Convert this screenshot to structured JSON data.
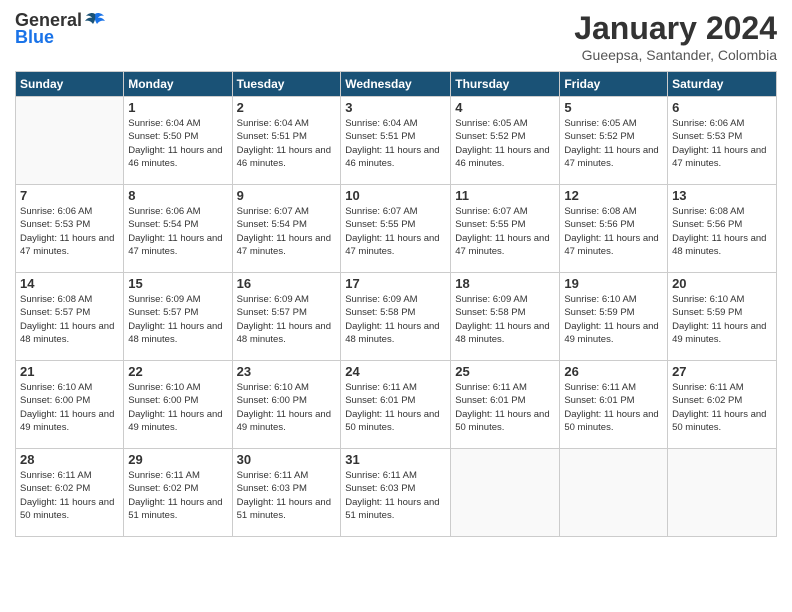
{
  "header": {
    "logo_general": "General",
    "logo_blue": "Blue",
    "month_title": "January 2024",
    "location": "Gueepsa, Santander, Colombia"
  },
  "days_of_week": [
    "Sunday",
    "Monday",
    "Tuesday",
    "Wednesday",
    "Thursday",
    "Friday",
    "Saturday"
  ],
  "weeks": [
    [
      {
        "day": "",
        "empty": true
      },
      {
        "day": "1",
        "sunrise": "6:04 AM",
        "sunset": "5:50 PM",
        "daylight": "11 hours and 46 minutes."
      },
      {
        "day": "2",
        "sunrise": "6:04 AM",
        "sunset": "5:51 PM",
        "daylight": "11 hours and 46 minutes."
      },
      {
        "day": "3",
        "sunrise": "6:04 AM",
        "sunset": "5:51 PM",
        "daylight": "11 hours and 46 minutes."
      },
      {
        "day": "4",
        "sunrise": "6:05 AM",
        "sunset": "5:52 PM",
        "daylight": "11 hours and 46 minutes."
      },
      {
        "day": "5",
        "sunrise": "6:05 AM",
        "sunset": "5:52 PM",
        "daylight": "11 hours and 47 minutes."
      },
      {
        "day": "6",
        "sunrise": "6:06 AM",
        "sunset": "5:53 PM",
        "daylight": "11 hours and 47 minutes."
      }
    ],
    [
      {
        "day": "7",
        "sunrise": "6:06 AM",
        "sunset": "5:53 PM",
        "daylight": "11 hours and 47 minutes."
      },
      {
        "day": "8",
        "sunrise": "6:06 AM",
        "sunset": "5:54 PM",
        "daylight": "11 hours and 47 minutes."
      },
      {
        "day": "9",
        "sunrise": "6:07 AM",
        "sunset": "5:54 PM",
        "daylight": "11 hours and 47 minutes."
      },
      {
        "day": "10",
        "sunrise": "6:07 AM",
        "sunset": "5:55 PM",
        "daylight": "11 hours and 47 minutes."
      },
      {
        "day": "11",
        "sunrise": "6:07 AM",
        "sunset": "5:55 PM",
        "daylight": "11 hours and 47 minutes."
      },
      {
        "day": "12",
        "sunrise": "6:08 AM",
        "sunset": "5:56 PM",
        "daylight": "11 hours and 47 minutes."
      },
      {
        "day": "13",
        "sunrise": "6:08 AM",
        "sunset": "5:56 PM",
        "daylight": "11 hours and 48 minutes."
      }
    ],
    [
      {
        "day": "14",
        "sunrise": "6:08 AM",
        "sunset": "5:57 PM",
        "daylight": "11 hours and 48 minutes."
      },
      {
        "day": "15",
        "sunrise": "6:09 AM",
        "sunset": "5:57 PM",
        "daylight": "11 hours and 48 minutes."
      },
      {
        "day": "16",
        "sunrise": "6:09 AM",
        "sunset": "5:57 PM",
        "daylight": "11 hours and 48 minutes."
      },
      {
        "day": "17",
        "sunrise": "6:09 AM",
        "sunset": "5:58 PM",
        "daylight": "11 hours and 48 minutes."
      },
      {
        "day": "18",
        "sunrise": "6:09 AM",
        "sunset": "5:58 PM",
        "daylight": "11 hours and 48 minutes."
      },
      {
        "day": "19",
        "sunrise": "6:10 AM",
        "sunset": "5:59 PM",
        "daylight": "11 hours and 49 minutes."
      },
      {
        "day": "20",
        "sunrise": "6:10 AM",
        "sunset": "5:59 PM",
        "daylight": "11 hours and 49 minutes."
      }
    ],
    [
      {
        "day": "21",
        "sunrise": "6:10 AM",
        "sunset": "6:00 PM",
        "daylight": "11 hours and 49 minutes."
      },
      {
        "day": "22",
        "sunrise": "6:10 AM",
        "sunset": "6:00 PM",
        "daylight": "11 hours and 49 minutes."
      },
      {
        "day": "23",
        "sunrise": "6:10 AM",
        "sunset": "6:00 PM",
        "daylight": "11 hours and 49 minutes."
      },
      {
        "day": "24",
        "sunrise": "6:11 AM",
        "sunset": "6:01 PM",
        "daylight": "11 hours and 50 minutes."
      },
      {
        "day": "25",
        "sunrise": "6:11 AM",
        "sunset": "6:01 PM",
        "daylight": "11 hours and 50 minutes."
      },
      {
        "day": "26",
        "sunrise": "6:11 AM",
        "sunset": "6:01 PM",
        "daylight": "11 hours and 50 minutes."
      },
      {
        "day": "27",
        "sunrise": "6:11 AM",
        "sunset": "6:02 PM",
        "daylight": "11 hours and 50 minutes."
      }
    ],
    [
      {
        "day": "28",
        "sunrise": "6:11 AM",
        "sunset": "6:02 PM",
        "daylight": "11 hours and 50 minutes."
      },
      {
        "day": "29",
        "sunrise": "6:11 AM",
        "sunset": "6:02 PM",
        "daylight": "11 hours and 51 minutes."
      },
      {
        "day": "30",
        "sunrise": "6:11 AM",
        "sunset": "6:03 PM",
        "daylight": "11 hours and 51 minutes."
      },
      {
        "day": "31",
        "sunrise": "6:11 AM",
        "sunset": "6:03 PM",
        "daylight": "11 hours and 51 minutes."
      },
      {
        "day": "",
        "empty": true
      },
      {
        "day": "",
        "empty": true
      },
      {
        "day": "",
        "empty": true
      }
    ]
  ]
}
